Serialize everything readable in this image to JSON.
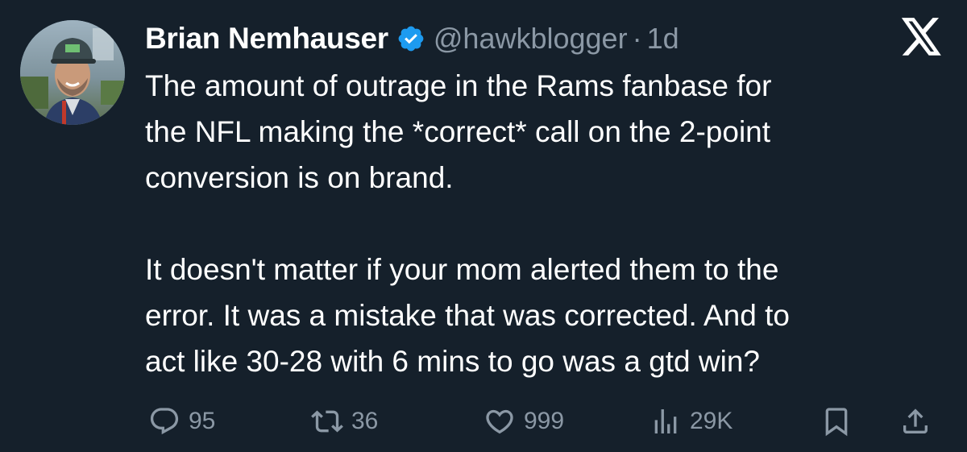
{
  "author": {
    "display_name": "Brian Nemhauser",
    "handle": "@hawkblogger",
    "separator": "·",
    "time": "1d",
    "verified": true
  },
  "tweet": {
    "paragraphs": [
      "The amount of outrage in the Rams fanbase for\nthe NFL making the *correct* call on the 2-point\nconversion is on brand.",
      "It doesn't matter if your mom alerted them to the\nerror. It was a mistake that was corrected. And to\nact like 30-28 with 6 mins to go was a gtd win?"
    ]
  },
  "actions": {
    "reply_count": "95",
    "retweet_count": "36",
    "like_count": "999",
    "views_count": "29K"
  },
  "icons": {
    "reply": "reply-icon",
    "retweet": "retweet-icon",
    "like": "heart-icon",
    "views": "views-icon",
    "bookmark": "bookmark-icon",
    "share": "share-icon",
    "brand": "x-logo-icon",
    "verified": "verified-badge-icon"
  },
  "colors": {
    "background": "#15202b",
    "text_primary": "#ffffff",
    "text_secondary": "#8b98a5",
    "verified_blue": "#1d9bf0"
  }
}
